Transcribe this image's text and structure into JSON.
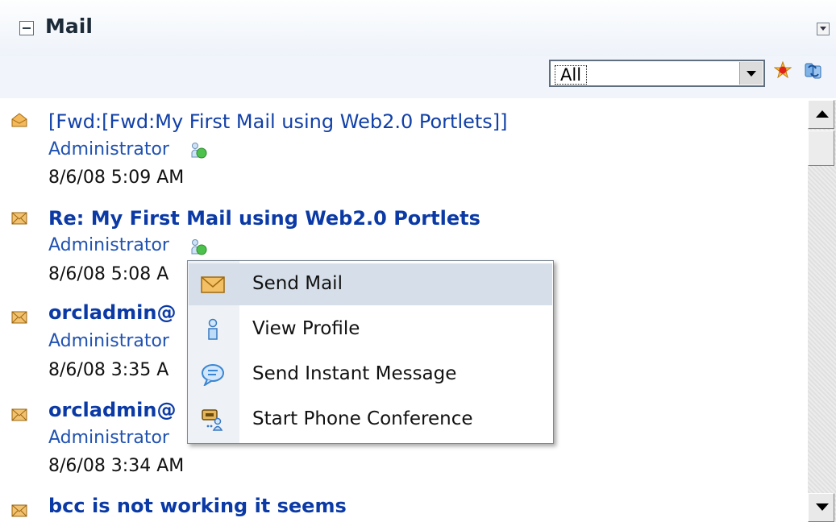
{
  "portlet": {
    "title": "Mail",
    "filter": {
      "selected": "All"
    }
  },
  "mail_items": [
    {
      "subject": "[Fwd:[Fwd:My First Mail using Web2.0 Portlets]]",
      "from": "Administrator",
      "date": "8/6/08 5:09 AM",
      "read": true
    },
    {
      "subject": "Re: My First Mail using Web2.0 Portlets",
      "from": "Administrator",
      "date": "8/6/08 5:08 A",
      "read": false
    },
    {
      "subject": "orcladmin@",
      "from": "Administrator",
      "date": "8/6/08 3:35 A",
      "read": false
    },
    {
      "subject": "orcladmin@",
      "from": "Administrator",
      "date": "8/6/08 3:34 AM",
      "read": false
    },
    {
      "subject": "bcc is not working it seems",
      "read": false
    }
  ],
  "context_menu": {
    "items": [
      {
        "label": "Send Mail",
        "icon": "envelope-icon",
        "selected": true
      },
      {
        "label": "View Profile",
        "icon": "person-icon"
      },
      {
        "label": "Send Instant Message",
        "icon": "chat-bubble-icon"
      },
      {
        "label": "Start Phone Conference",
        "icon": "phone-conference-icon"
      }
    ]
  },
  "colors": {
    "link": "#1140a8",
    "header_bg": "#eef3fa",
    "menu_selected": "#d6dfe9",
    "envelope": "#e8a33c"
  }
}
